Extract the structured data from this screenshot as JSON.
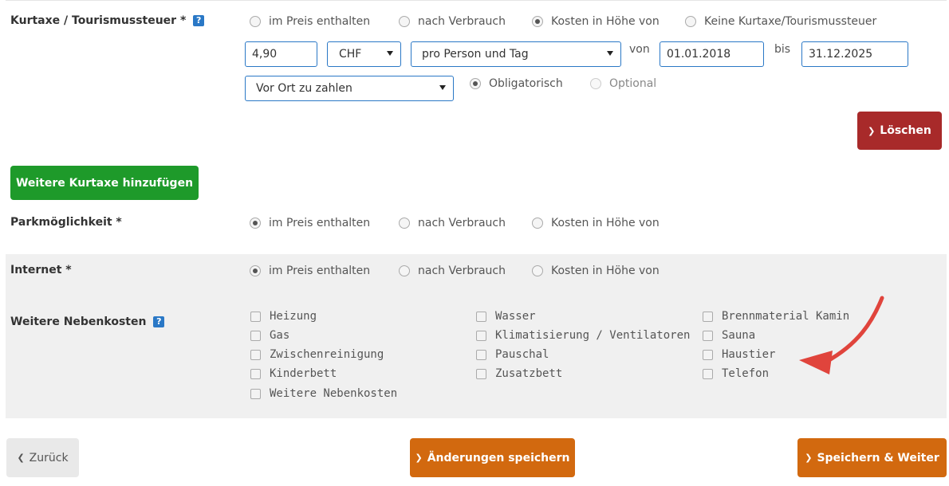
{
  "kurtaxe": {
    "label": "Kurtaxe / Tourismussteuer *",
    "help": "?",
    "options": [
      "im Preis enthalten",
      "nach Verbrauch",
      "Kosten in Höhe von",
      "Keine Kurtaxe/Tourismussteuer"
    ],
    "selected_index": 2,
    "amount": "4,90",
    "currency": "CHF",
    "basis": "pro Person und Tag",
    "from_label": "von",
    "from_date": "01.01.2018",
    "to_label": "bis",
    "to_date": "31.12.2025",
    "payment": "Vor Ort zu zahlen",
    "obligation_options": [
      "Obligatorisch",
      "Optional"
    ],
    "obligation_selected_index": 0,
    "delete_button": "Löschen",
    "add_button": "Weitere Kurtaxe hinzufügen"
  },
  "parking": {
    "label": "Parkmöglichkeit *",
    "options": [
      "im Preis enthalten",
      "nach Verbrauch",
      "Kosten in Höhe von"
    ],
    "selected_index": 0
  },
  "internet": {
    "label": "Internet *",
    "options": [
      "im Preis enthalten",
      "nach Verbrauch",
      "Kosten in Höhe von"
    ],
    "selected_index": 0
  },
  "extras": {
    "label": "Weitere Nebenkosten",
    "help": "?",
    "col1": [
      "Heizung",
      "Gas",
      "Zwischenreinigung",
      "Kinderbett",
      "Weitere Nebenkosten"
    ],
    "col2": [
      "Wasser",
      "Klimatisierung / Ventilatoren",
      "Pauschal",
      "Zusatzbett"
    ],
    "col3": [
      "Brennmaterial Kamin",
      "Sauna",
      "Haustier",
      "Telefon"
    ]
  },
  "footer": {
    "back": "Zurück",
    "save": "Änderungen speichern",
    "save_next": "Speichern & Weiter"
  },
  "colors": {
    "annotation_arrow": "#e0443c"
  }
}
